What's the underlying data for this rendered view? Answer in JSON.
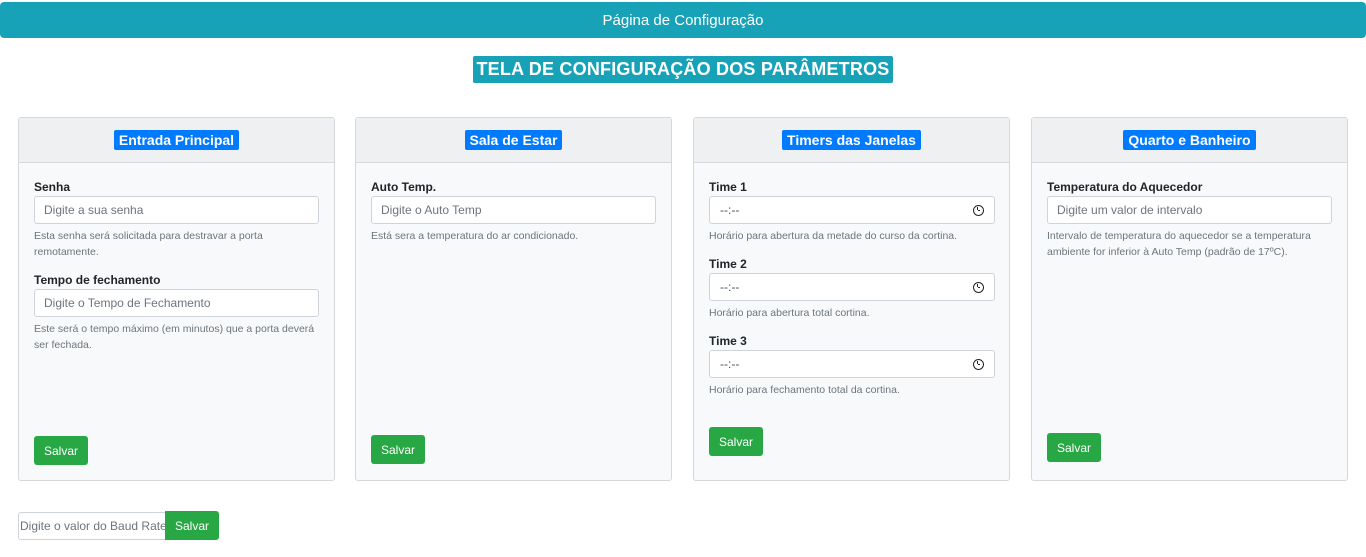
{
  "topbar": {
    "title": "Página de Configuração"
  },
  "heading": "TELA DE CONFIGURAÇÃO DOS PARÂMETROS",
  "cards": {
    "entrada": {
      "title": "Entrada Principal",
      "senha_label": "Senha",
      "senha_placeholder": "Digite a sua senha",
      "senha_help": "Esta senha será solicitada para destravar a porta remotamente.",
      "tempo_label": "Tempo de fechamento",
      "tempo_placeholder": "Digite o Tempo de Fechamento",
      "tempo_help": "Este será o tempo máximo (em minutos) que a porta deverá ser fechada.",
      "save_label": "Salvar"
    },
    "sala": {
      "title": "Sala de Estar",
      "auto_label": "Auto Temp.",
      "auto_placeholder": "Digite o Auto Temp",
      "auto_help": "Está sera a temperatura do ar condicionado.",
      "save_label": "Salvar"
    },
    "timers": {
      "title": "Timers das Janelas",
      "time1_label": "Time 1",
      "time1_value": "--:--",
      "time1_help": "Horário para abertura da metade do curso da cortina.",
      "time2_label": "Time 2",
      "time2_value": "--:--",
      "time2_help": "Horário para abertura total cortina.",
      "time3_label": "Time 3",
      "time3_value": "--:--",
      "time3_help": "Horário para fechamento total da cortina.",
      "save_label": "Salvar"
    },
    "quarto": {
      "title": "Quarto e Banheiro",
      "temp_label": "Temperatura do Aquecedor",
      "temp_placeholder": "Digite um valor de intervalo",
      "temp_help": "Intervalo de temperatura do aquecedor se a temperatura ambiente for inferior à Auto Temp (padrão de 17ºC).",
      "save_label": "Salvar"
    }
  },
  "baud": {
    "placeholder": "Digite o valor do Baud Rate",
    "save_label": "Salvar"
  },
  "icons": {
    "time_picker": "clock-icon"
  },
  "colors": {
    "header": "#17a2b8",
    "card_title": "#007bff",
    "save_button": "#28a745"
  }
}
